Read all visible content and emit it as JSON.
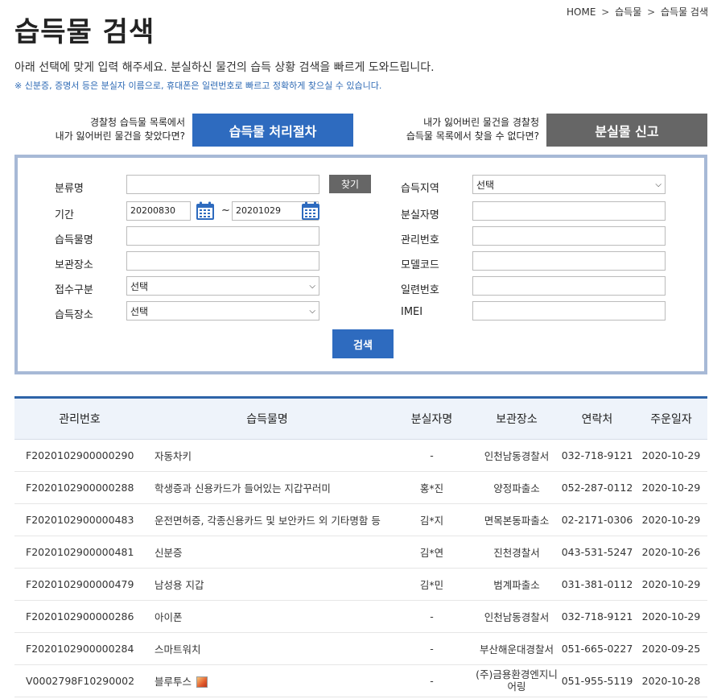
{
  "breadcrumb": {
    "home": "HOME",
    "level1": "습득물",
    "level2": "습득물 검색",
    "separator": ">"
  },
  "page_title": "습득물 검색",
  "description": "아래 선택에 맞게 입력 해주세요. 분실하신 물건의 습득 상황 검색을 빠르게 도와드립니다.",
  "note": "※ 신분증, 증명서 등은 분실자 이름으로, 휴대폰은 일련번호로 빠르고 정확하게 찾으실 수 있습니다.",
  "promo": {
    "left_line1": "경찰청 습득물 목록에서",
    "left_line2": "내가 잃어버린 물건을 찾았다면?",
    "process_button": "습득물 처리절차",
    "right_line1": "내가 잃어버린 물건을 경찰청",
    "right_line2": "습득물 목록에서 찾을 수 없다면?",
    "report_button": "분실물 신고"
  },
  "form": {
    "category_label": "분류명",
    "category_value": "",
    "find_button": "찾기",
    "period_label": "기간",
    "date_from": "20200830",
    "date_to": "20201029",
    "tilde": "~",
    "item_name_label": "습득물명",
    "storage_label": "보관장소",
    "receipt_type_label": "접수구분",
    "receipt_type_value": "선택",
    "found_place_label": "습득장소",
    "found_place_value": "선택",
    "found_region_label": "습득지역",
    "found_region_value": "선택",
    "owner_name_label": "분실자명",
    "manage_no_label": "관리번호",
    "model_code_label": "모델코드",
    "serial_no_label": "일련번호",
    "imei_label": "IMEI",
    "search_button": "검색"
  },
  "table": {
    "headers": [
      "관리번호",
      "습득물명",
      "분실자명",
      "보관장소",
      "연락처",
      "주운일자"
    ],
    "rows": [
      {
        "id": "F2020102900000290",
        "name": "자동차키",
        "owner": "-",
        "place": "인천남동경찰서",
        "phone": "032-718-9121",
        "date": "2020-10-29",
        "has_image": false
      },
      {
        "id": "F2020102900000288",
        "name": "학생증과 신용카드가 들어있는 지갑꾸러미",
        "owner": "홍*진",
        "place": "양정파출소",
        "phone": "052-287-0112",
        "date": "2020-10-29",
        "has_image": false
      },
      {
        "id": "F2020102900000483",
        "name": "운전면허증, 각종신용카드 및 보안카드 외 기타명함 등",
        "owner": "김*지",
        "place": "면목본동파출소",
        "phone": "02-2171-0306",
        "date": "2020-10-29",
        "has_image": false
      },
      {
        "id": "F2020102900000481",
        "name": "신분증",
        "owner": "김*연",
        "place": "진천경찰서",
        "phone": "043-531-5247",
        "date": "2020-10-26",
        "has_image": false
      },
      {
        "id": "F2020102900000479",
        "name": "남성용 지갑",
        "owner": "김*민",
        "place": "범계파출소",
        "phone": "031-381-0112",
        "date": "2020-10-29",
        "has_image": false
      },
      {
        "id": "F2020102900000286",
        "name": "아이폰",
        "owner": "-",
        "place": "인천남동경찰서",
        "phone": "032-718-9121",
        "date": "2020-10-29",
        "has_image": false
      },
      {
        "id": "F2020102900000284",
        "name": "스마트워치",
        "owner": "-",
        "place": "부산해운대경찰서",
        "phone": "051-665-0227",
        "date": "2020-09-25",
        "has_image": false
      },
      {
        "id": "V0002798F10290002",
        "name": "블루투스",
        "owner": "-",
        "place": "(주)금용환경엔지니어링",
        "phone": "051-955-5119",
        "date": "2020-10-28",
        "has_image": true
      }
    ]
  }
}
